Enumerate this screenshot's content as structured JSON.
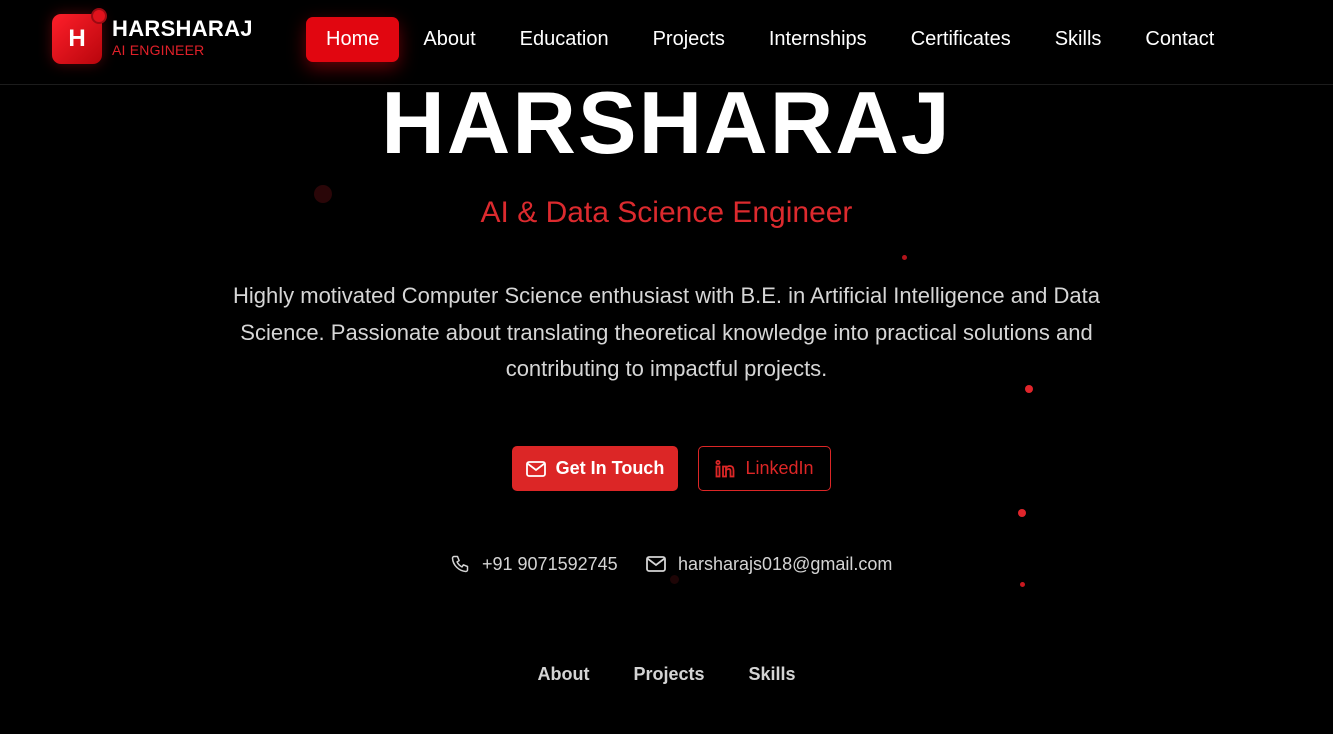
{
  "brand": {
    "initial": "H",
    "name": "HARSHARAJ",
    "tagline": "AI ENGINEER"
  },
  "nav": {
    "items": [
      {
        "label": "Home",
        "active": true
      },
      {
        "label": "About"
      },
      {
        "label": "Education"
      },
      {
        "label": "Projects"
      },
      {
        "label": "Internships"
      },
      {
        "label": "Certificates"
      },
      {
        "label": "Skills"
      },
      {
        "label": "Contact"
      }
    ]
  },
  "hero": {
    "title": "HARSHARAJ",
    "subtitle": "AI & Data Science Engineer",
    "description": "Highly motivated Computer Science enthusiast with B.E. in Artificial Intelligence and Data Science. Passionate about translating theoretical knowledge into practical solutions and contributing to impactful projects.",
    "cta_primary": "Get In Touch",
    "cta_secondary": "LinkedIn"
  },
  "contact": {
    "phone": "+91 9071592745",
    "email": "harsharajs018@gmail.com"
  },
  "footer_links": [
    "About",
    "Projects",
    "Skills"
  ],
  "colors": {
    "accent": "#dc2626",
    "background": "#000000"
  },
  "icons": {
    "primary_button": "mail-icon",
    "secondary_button": "linkedin-icon",
    "phone": "phone-icon",
    "email": "mail-icon"
  }
}
